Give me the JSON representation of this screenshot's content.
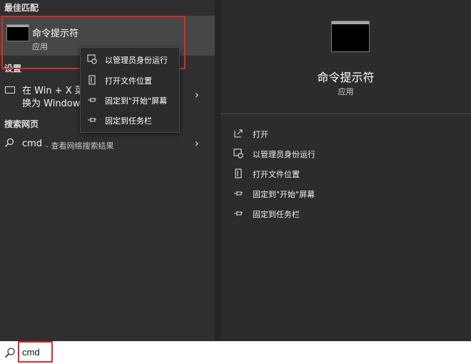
{
  "left": {
    "best_match": {
      "section_title": "最佳匹配",
      "name": "命令提示符",
      "type": "应用",
      "icon": "terminal-icon"
    },
    "settings": {
      "section_title": "设置",
      "line1": "在 Win + X 菜",
      "line2": "换为 Window",
      "icon": "display-icon"
    },
    "web": {
      "section_title": "搜索网页",
      "query": "cmd",
      "desc": " - 查看网络搜索结果",
      "icon": "search-icon"
    }
  },
  "context_menu": {
    "items": [
      {
        "label": "以管理员身份运行",
        "icon": "shield-run-icon"
      },
      {
        "label": "打开文件位置",
        "icon": "file-location-icon"
      },
      {
        "label": "固定到\"开始\"屏幕",
        "icon": "pin-icon"
      },
      {
        "label": "固定到任务栏",
        "icon": "pin-icon"
      }
    ]
  },
  "detail": {
    "name": "命令提示符",
    "type": "应用",
    "actions": [
      {
        "label": "打开",
        "icon": "open-icon"
      },
      {
        "label": "以管理员身份运行",
        "icon": "shield-run-icon"
      },
      {
        "label": "打开文件位置",
        "icon": "file-location-icon"
      },
      {
        "label": "固定到\"开始\"屏幕",
        "icon": "pin-icon"
      },
      {
        "label": "固定到任务栏",
        "icon": "pin-icon"
      }
    ]
  },
  "search": {
    "value": "cmd",
    "icon": "search-icon"
  },
  "colors": {
    "highlight_border": "#d92b2b",
    "panel_bg": "#2c2c2c",
    "selected_bg": "#474747"
  }
}
